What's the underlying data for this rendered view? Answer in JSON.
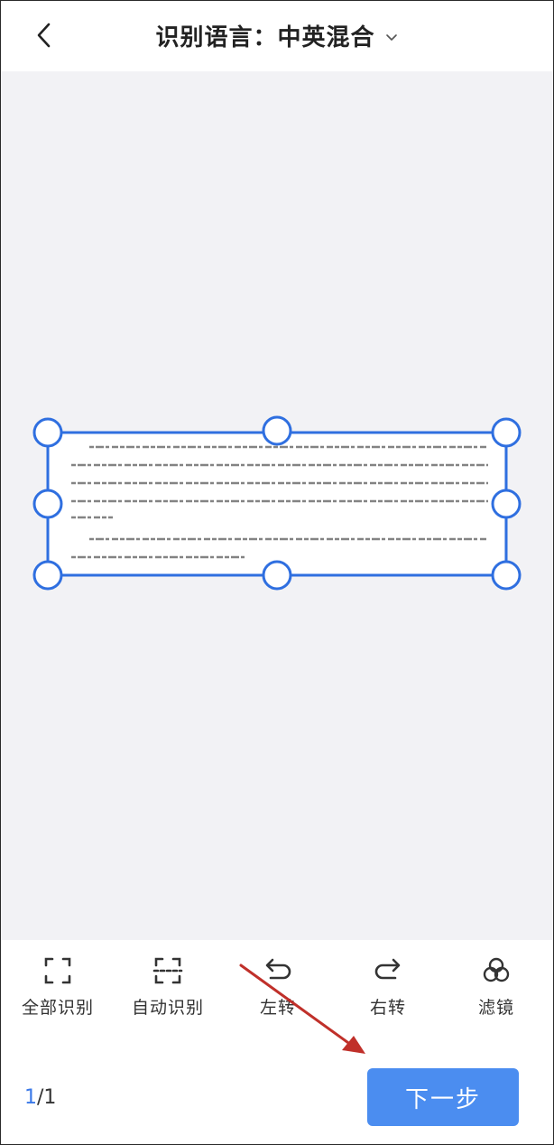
{
  "header": {
    "title": "识别语言：中英混合"
  },
  "toolbar": {
    "items": [
      {
        "label": "全部识别",
        "icon": "full-frame-icon"
      },
      {
        "label": "自动识别",
        "icon": "auto-frame-icon"
      },
      {
        "label": "左转",
        "icon": "rotate-left-icon"
      },
      {
        "label": "右转",
        "icon": "rotate-right-icon"
      },
      {
        "label": "滤镜",
        "icon": "filter-icon"
      }
    ]
  },
  "footer": {
    "page_current": "1",
    "page_total": "/1",
    "next_label": "下一步"
  },
  "colors": {
    "accent": "#4b8df0",
    "crop_handle": "#2f6fe0",
    "annotation_arrow": "#c0302a"
  }
}
